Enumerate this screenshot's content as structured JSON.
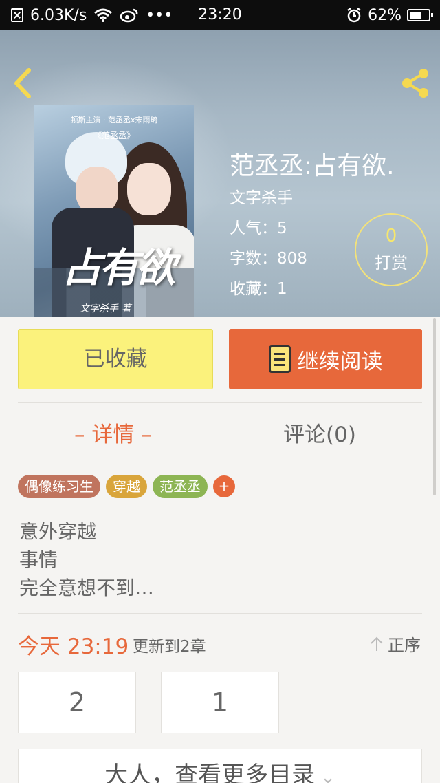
{
  "status_bar": {
    "network_speed": "6.03K/s",
    "time": "23:20",
    "battery": "62%",
    "battery_level": 0.62,
    "more": "•••"
  },
  "book": {
    "title": "范丞丞:占有欲.",
    "author": "文字杀手",
    "popularity": "人气：5",
    "word_count": "字数：808",
    "favorites": "收藏：1",
    "reward_count": "0",
    "reward_label": "打赏",
    "cover": {
      "top_line": "顿斯主演 · 范丞丞x宋雨琦",
      "sub_line": "《范丞丞》",
      "big_text": "占有欲",
      "author_line": "文字杀手 著"
    }
  },
  "actions": {
    "favorited_label": "已收藏",
    "continue_label": "继续阅读"
  },
  "tabs": {
    "details": "– 详情 –",
    "comments": "评论(0)"
  },
  "tags": [
    {
      "label": "偶像练习生",
      "color": "#c0745e"
    },
    {
      "label": "穿越",
      "color": "#d9a53b"
    },
    {
      "label": "范丞丞",
      "color": "#8db554"
    }
  ],
  "tag_add": "+",
  "description": [
    "意外穿越",
    "事情",
    "完全意想不到…"
  ],
  "update": {
    "time": "今天 23:19",
    "text": "更新到2章",
    "sort_label": "正序"
  },
  "chapters": [
    "2",
    "1"
  ],
  "more_catalog": "大人，查看更多目录",
  "colors": {
    "accent": "#e7683b",
    "favorite_bg": "#fbf27c"
  }
}
